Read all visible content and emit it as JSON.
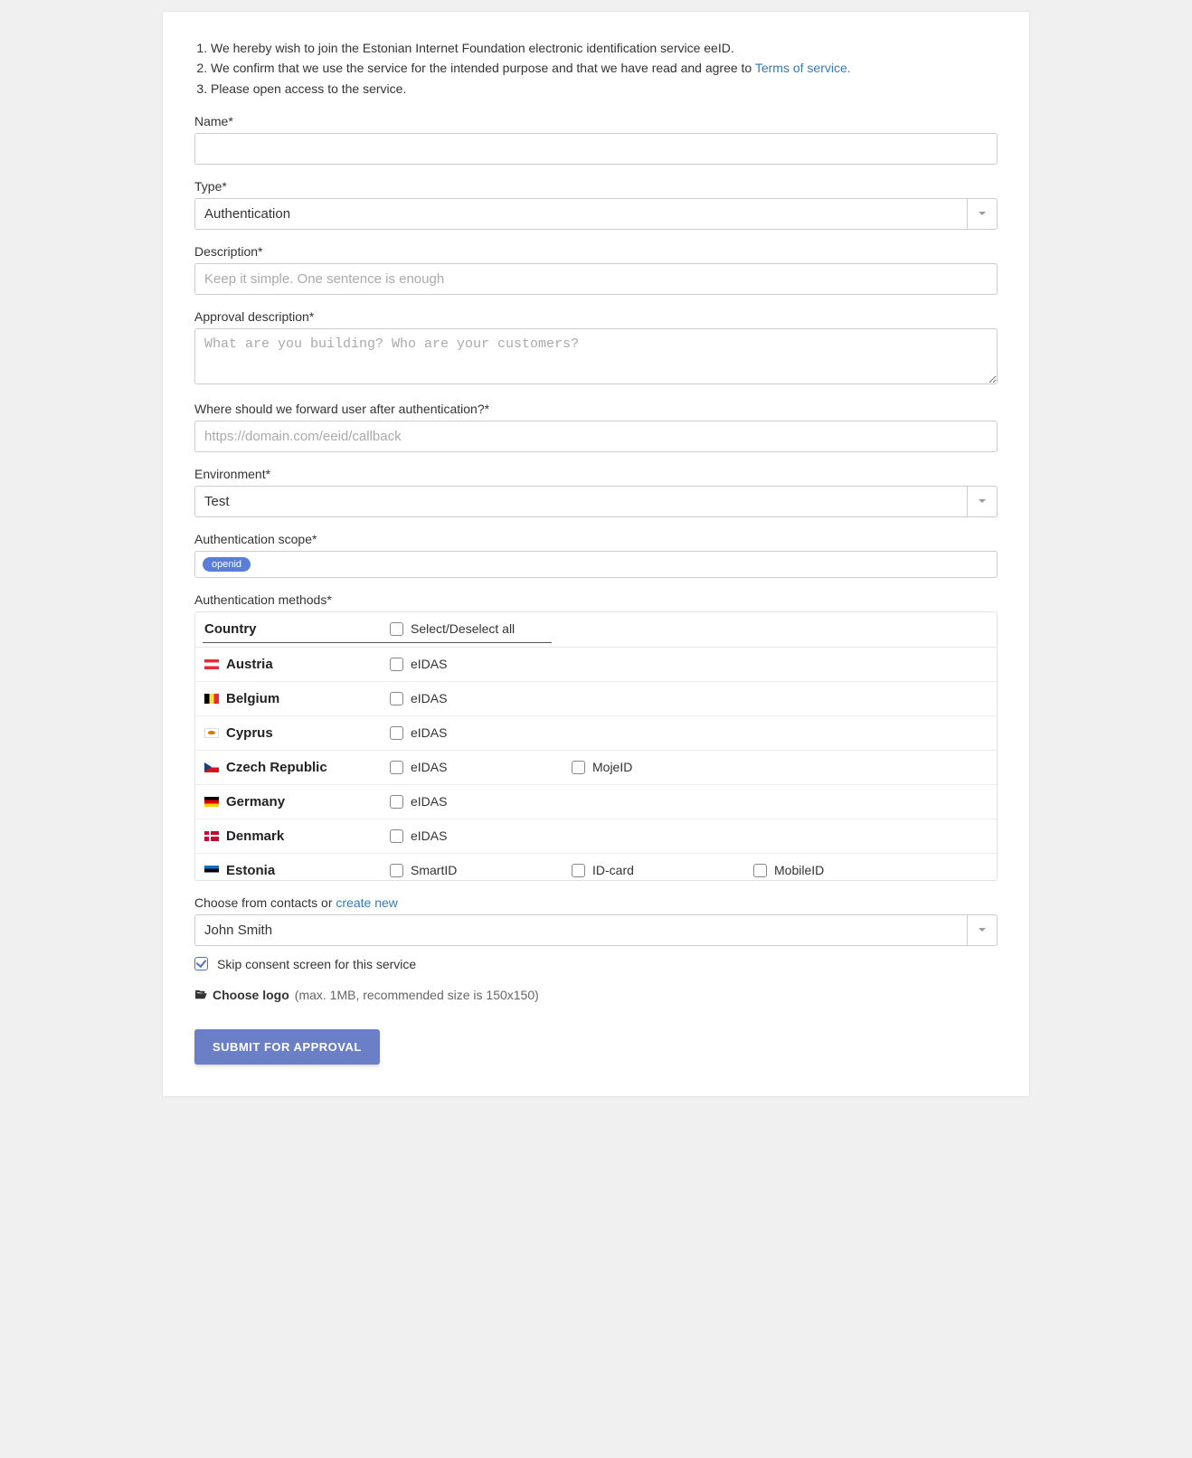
{
  "intro": {
    "i1": "We hereby wish to join the Estonian Internet Foundation electronic identification service eeID.",
    "i2_a": "We confirm that we use the service for the intended purpose and that we have read and agree to ",
    "i2_link": "Terms of service.",
    "i3": "Please open access to the service."
  },
  "name": {
    "label": "Name*",
    "value": ""
  },
  "type": {
    "label": "Type*",
    "value": "Authentication"
  },
  "desc": {
    "label": "Description*",
    "placeholder": "Keep it simple. One sentence is enough",
    "value": ""
  },
  "appdesc": {
    "label": "Approval description*",
    "placeholder": "What are you building? Who are your customers?",
    "value": ""
  },
  "redirect": {
    "label": "Where should we forward user after authentication?*",
    "placeholder": "https://domain.com/eeid/callback",
    "value": ""
  },
  "env": {
    "label": "Environment*",
    "value": "Test"
  },
  "scope": {
    "label": "Authentication scope*",
    "tag": "openid"
  },
  "methods": {
    "label": "Authentication methods*",
    "country_col": "Country",
    "select_all": "Select/Deselect all",
    "rows": [
      {
        "flagcls": "flag-at",
        "name": "Austria",
        "opts": [
          "eIDAS"
        ]
      },
      {
        "flagcls": "flag-be",
        "name": "Belgium",
        "opts": [
          "eIDAS"
        ]
      },
      {
        "flagcls": "flag-cy",
        "name": "Cyprus",
        "opts": [
          "eIDAS"
        ]
      },
      {
        "flagcls": "flag-cz",
        "name": "Czech Republic",
        "opts": [
          "eIDAS",
          "MojeID"
        ]
      },
      {
        "flagcls": "flag-de",
        "name": "Germany",
        "opts": [
          "eIDAS"
        ]
      },
      {
        "flagcls": "flag-dk",
        "name": "Denmark",
        "opts": [
          "eIDAS"
        ]
      },
      {
        "flagcls": "flag-ee",
        "name": "Estonia",
        "opts": [
          "SmartID",
          "ID-card",
          "MobileID"
        ]
      }
    ]
  },
  "contact": {
    "label_a": "Choose from contacts or ",
    "label_link": "create new",
    "value": "John Smith"
  },
  "consent": {
    "label": "Skip consent screen for this service",
    "checked": true
  },
  "logo": {
    "label": "Choose logo",
    "hint": " (max. 1MB, recommended size is 150x150)"
  },
  "submit": {
    "label": "SUBMIT FOR APPROVAL"
  }
}
